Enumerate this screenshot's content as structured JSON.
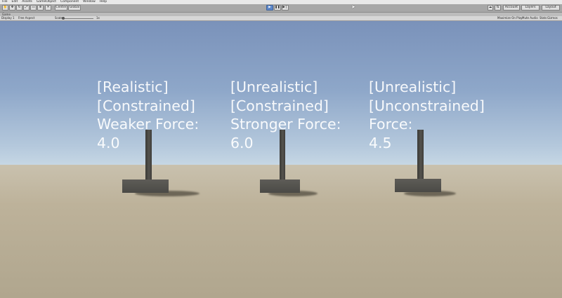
{
  "menu": [
    "File",
    "Edit",
    "Assets",
    "GameObject",
    "Component",
    "Window",
    "Help"
  ],
  "toolbar": {
    "pivot_label": "Center",
    "space_label": "Global",
    "play_icon": "play-icon",
    "pause_icon": "pause-icon",
    "step_icon": "step-icon",
    "account_label": "Account",
    "layers_label": "Layers",
    "layout_label": "Layout"
  },
  "game_tab": {
    "label": "Game"
  },
  "game_bar": {
    "display": "Display 1",
    "aspect": "Free Aspect",
    "scale_label": "Scale",
    "scale_value": "1x",
    "maximize_on_play": "Maximize On Play",
    "mute_audio": "Mute Audio",
    "stats": "Stats",
    "gizmos": "Gizmos"
  },
  "scene": {
    "labels": [
      {
        "lines": [
          "[Realistic]",
          "[Constrained]",
          "Weaker Force:",
          "4.0"
        ]
      },
      {
        "lines": [
          "[Unrealistic]",
          "[Constrained]",
          "Stronger Force:",
          "6.0"
        ]
      },
      {
        "lines": [
          "[Unrealistic]",
          "[Unconstrained]",
          "Force:",
          "4.5"
        ]
      }
    ]
  },
  "colors": {
    "sky_top": "#7a92ba",
    "horizon": "#e6eef1",
    "ground": "#bdb29a",
    "object": "#4f4d48",
    "play_active": "#5b86c9"
  }
}
